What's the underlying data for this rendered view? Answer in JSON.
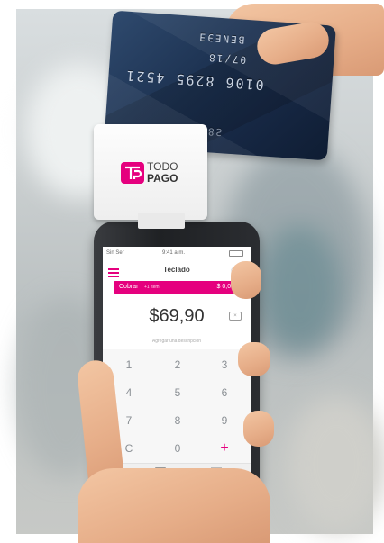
{
  "brand": {
    "line1": "TODO",
    "line2": "PAGO",
    "logo_icon": "todopago-logo-icon",
    "color": "#e5007e"
  },
  "card": {
    "name": "BENEЭƎ",
    "number": "0106 8295 4521",
    "expiry": "07/18",
    "small": "Ƨ8ƨ"
  },
  "phone": {
    "status": {
      "carrier": "Sin Ser",
      "time": "9:41 a.m."
    },
    "title": "Teclado",
    "charge_bar": {
      "label": "Cobrar",
      "count_label": "+1 item",
      "amount": "$ 0,00"
    },
    "amount_display": "$69,90",
    "description_placeholder": "Agregar una descripción",
    "keypad": [
      "1",
      "2",
      "3",
      "4",
      "5",
      "6",
      "7",
      "8",
      "9",
      "C",
      "0",
      "+"
    ],
    "accent": "#e5007e"
  }
}
